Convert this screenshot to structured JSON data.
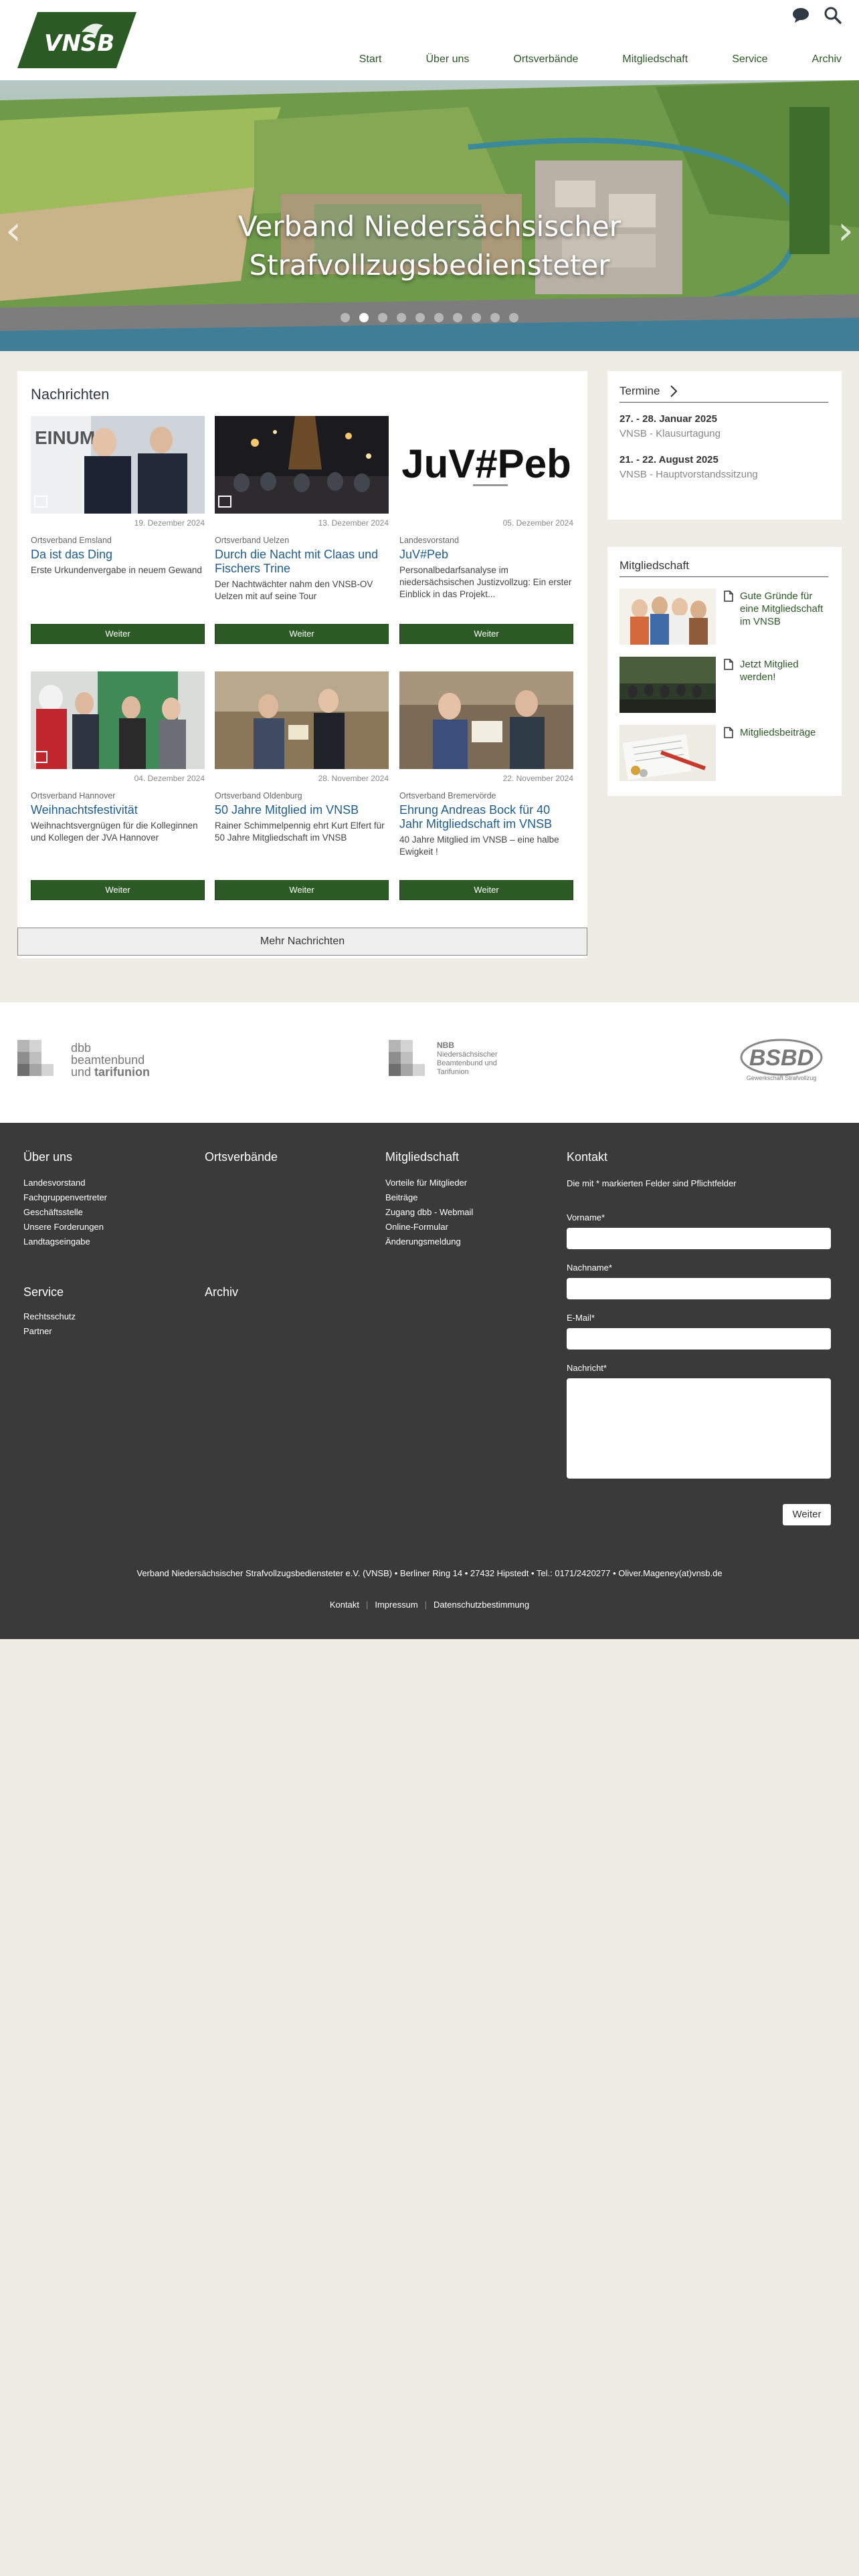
{
  "brand": {
    "logo_text": "VNSB",
    "green": "#2b5a25",
    "link_blue": "#1f5d8f"
  },
  "header": {
    "icons": [
      "chat-icon",
      "search-icon"
    ],
    "nav": [
      "Start",
      "Über uns",
      "Ortsverbände",
      "Mitgliedschaft",
      "Service",
      "Archiv"
    ]
  },
  "hero": {
    "title_line1": "Verband Niedersächsischer",
    "title_line2": "Strafvollzugsbediensteter",
    "slides": 10,
    "active_slide": 1
  },
  "news": {
    "title": "Nachrichten",
    "cards": [
      {
        "date": "19. Dezember 2024",
        "category": "Ortsverband Emsland",
        "headline": "Da ist das Ding",
        "text": "Erste Urkundenvergabe in neuem Gewand",
        "button": "Weiter",
        "image_text": "EINUM"
      },
      {
        "date": "13. Dezember 2024",
        "category": "Ortsverband Uelzen",
        "headline": "Durch die Nacht mit Claas und Fischers Trine",
        "text": "Der Nachtwächter nahm den VNSB-OV Uelzen mit auf seine Tour",
        "button": "Weiter"
      },
      {
        "date": "05. Dezember 2024",
        "category": "Landesvorstand",
        "headline": "JuV#Peb",
        "text": "Personalbedarfsanalyse im niedersächsischen Justizvollzug: Ein erster Einblick in das Projekt...",
        "button": "Weiter",
        "image_text": "JuV#Peb"
      },
      {
        "date": "04. Dezember 2024",
        "category": "Ortsverband Hannover",
        "headline": "Weihnachtsfestivität",
        "text": "Weihnachtsvergnügen für die Kolleginnen und Kollegen der JVA Hannover",
        "button": "Weiter"
      },
      {
        "date": "28. November 2024",
        "category": "Ortsverband Oldenburg",
        "headline": "50 Jahre Mitglied im VNSB",
        "text": "Rainer Schimmelpennig ehrt Kurt Elfert für 50 Jahre Mitgliedschaft im VNSB",
        "button": "Weiter"
      },
      {
        "date": "22. November 2024",
        "category": "Ortsverband Bremervörde",
        "headline": "Ehrung Andreas Bock für 40 Jahr Mitgliedschaft im VNSB",
        "text": "40 Jahre Mitglied im VNSB – eine halbe Ewigkeit !",
        "button": "Weiter"
      }
    ],
    "more_button": "Mehr Nachrichten"
  },
  "sidebar": {
    "termine": {
      "title": "Termine",
      "items": [
        {
          "date": "27. - 28. Januar 2025",
          "name": "VNSB - Klausurtagung"
        },
        {
          "date": "21. - 22. August 2025",
          "name": "VNSB - Hauptvorstandssitzung"
        }
      ]
    },
    "mitgliedschaft": {
      "title": "Mitgliedschaft",
      "items": [
        {
          "label": "Gute Gründe für eine Mitgliedschaft im VNSB"
        },
        {
          "label": "Jetzt Mitglied werden!"
        },
        {
          "label": "Mitgliedsbeiträge"
        }
      ]
    }
  },
  "partners": {
    "dbb_line1": "dbb",
    "dbb_line2": "beamtenbund",
    "dbb_line3a": "und ",
    "dbb_line3b": "tarifunion",
    "nbb_line1": "NBB",
    "nbb_line2": "Niedersächsischer",
    "nbb_line3": "Beamtenbund und",
    "nbb_line4": "Tarifunion",
    "bsbd_line1": "BSBD",
    "bsbd_line2": "Gewerkschaft Strafvollzug"
  },
  "footer": {
    "ueber_uns": {
      "title": "Über uns",
      "links": [
        "Landesvorstand",
        "Fachgruppenvertreter",
        "Geschäftsstelle",
        "Unsere Forderungen",
        "Landtagseingabe"
      ]
    },
    "ortsverbaende": {
      "title": "Ortsverbände"
    },
    "mitgliedschaft": {
      "title": "Mitgliedschaft",
      "links": [
        "Vorteile für Mitglieder",
        "Beiträge",
        "Zugang dbb - Webmail",
        "Online-Formular",
        "Änderungsmeldung"
      ]
    },
    "service": {
      "title": "Service",
      "links": [
        "Rechtsschutz",
        "Partner"
      ]
    },
    "archiv": {
      "title": "Archiv"
    },
    "kontakt": {
      "title": "Kontakt",
      "note": "Die mit * markierten Felder sind Pflichtfelder",
      "fields": [
        "Vorname*",
        "Nachname*",
        "E-Mail*",
        "Nachricht*"
      ],
      "submit": "Weiter"
    },
    "address": "Verband Niedersächsischer Strafvollzugsbediensteter e.V. (VNSB)  •  Berliner Ring 14  •  27432 Hipstedt  •  Tel.: 0171/2420277  •  Oliver.Mageney(at)vnsb.de",
    "bottom_links": [
      "Kontakt",
      "Impressum",
      "Datenschutzbestimmung"
    ]
  }
}
